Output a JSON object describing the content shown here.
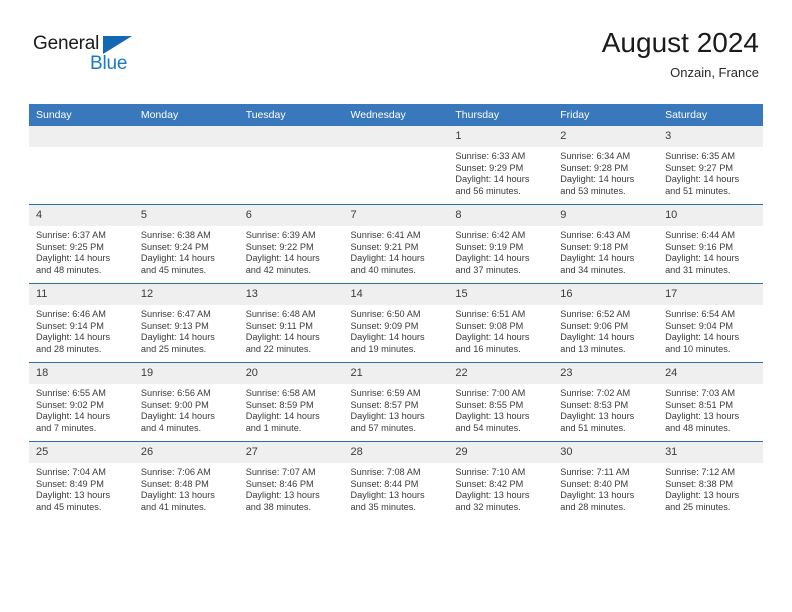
{
  "brand": {
    "name_dark": "General",
    "name_blue": "Blue",
    "triangle_color": "#1268b3",
    "blue_color": "#1a7bc4"
  },
  "header": {
    "month_title": "August 2024",
    "location": "Onzain, France"
  },
  "theme": {
    "header_bg": "#3a78bd",
    "row_border": "#2f6ca8",
    "daynum_bg": "#efefef",
    "text": "#3b3b3b"
  },
  "calendar": {
    "weekday_headers": [
      "Sunday",
      "Monday",
      "Tuesday",
      "Wednesday",
      "Thursday",
      "Friday",
      "Saturday"
    ],
    "weeks": [
      [
        {
          "day": "",
          "empty": true
        },
        {
          "day": "",
          "empty": true
        },
        {
          "day": "",
          "empty": true
        },
        {
          "day": "",
          "empty": true
        },
        {
          "day": "1",
          "sunrise": "Sunrise: 6:33 AM",
          "sunset": "Sunset: 9:29 PM",
          "daylight_1": "Daylight: 14 hours",
          "daylight_2": "and 56 minutes."
        },
        {
          "day": "2",
          "sunrise": "Sunrise: 6:34 AM",
          "sunset": "Sunset: 9:28 PM",
          "daylight_1": "Daylight: 14 hours",
          "daylight_2": "and 53 minutes."
        },
        {
          "day": "3",
          "sunrise": "Sunrise: 6:35 AM",
          "sunset": "Sunset: 9:27 PM",
          "daylight_1": "Daylight: 14 hours",
          "daylight_2": "and 51 minutes."
        }
      ],
      [
        {
          "day": "4",
          "sunrise": "Sunrise: 6:37 AM",
          "sunset": "Sunset: 9:25 PM",
          "daylight_1": "Daylight: 14 hours",
          "daylight_2": "and 48 minutes."
        },
        {
          "day": "5",
          "sunrise": "Sunrise: 6:38 AM",
          "sunset": "Sunset: 9:24 PM",
          "daylight_1": "Daylight: 14 hours",
          "daylight_2": "and 45 minutes."
        },
        {
          "day": "6",
          "sunrise": "Sunrise: 6:39 AM",
          "sunset": "Sunset: 9:22 PM",
          "daylight_1": "Daylight: 14 hours",
          "daylight_2": "and 42 minutes."
        },
        {
          "day": "7",
          "sunrise": "Sunrise: 6:41 AM",
          "sunset": "Sunset: 9:21 PM",
          "daylight_1": "Daylight: 14 hours",
          "daylight_2": "and 40 minutes."
        },
        {
          "day": "8",
          "sunrise": "Sunrise: 6:42 AM",
          "sunset": "Sunset: 9:19 PM",
          "daylight_1": "Daylight: 14 hours",
          "daylight_2": "and 37 minutes."
        },
        {
          "day": "9",
          "sunrise": "Sunrise: 6:43 AM",
          "sunset": "Sunset: 9:18 PM",
          "daylight_1": "Daylight: 14 hours",
          "daylight_2": "and 34 minutes."
        },
        {
          "day": "10",
          "sunrise": "Sunrise: 6:44 AM",
          "sunset": "Sunset: 9:16 PM",
          "daylight_1": "Daylight: 14 hours",
          "daylight_2": "and 31 minutes."
        }
      ],
      [
        {
          "day": "11",
          "sunrise": "Sunrise: 6:46 AM",
          "sunset": "Sunset: 9:14 PM",
          "daylight_1": "Daylight: 14 hours",
          "daylight_2": "and 28 minutes."
        },
        {
          "day": "12",
          "sunrise": "Sunrise: 6:47 AM",
          "sunset": "Sunset: 9:13 PM",
          "daylight_1": "Daylight: 14 hours",
          "daylight_2": "and 25 minutes."
        },
        {
          "day": "13",
          "sunrise": "Sunrise: 6:48 AM",
          "sunset": "Sunset: 9:11 PM",
          "daylight_1": "Daylight: 14 hours",
          "daylight_2": "and 22 minutes."
        },
        {
          "day": "14",
          "sunrise": "Sunrise: 6:50 AM",
          "sunset": "Sunset: 9:09 PM",
          "daylight_1": "Daylight: 14 hours",
          "daylight_2": "and 19 minutes."
        },
        {
          "day": "15",
          "sunrise": "Sunrise: 6:51 AM",
          "sunset": "Sunset: 9:08 PM",
          "daylight_1": "Daylight: 14 hours",
          "daylight_2": "and 16 minutes."
        },
        {
          "day": "16",
          "sunrise": "Sunrise: 6:52 AM",
          "sunset": "Sunset: 9:06 PM",
          "daylight_1": "Daylight: 14 hours",
          "daylight_2": "and 13 minutes."
        },
        {
          "day": "17",
          "sunrise": "Sunrise: 6:54 AM",
          "sunset": "Sunset: 9:04 PM",
          "daylight_1": "Daylight: 14 hours",
          "daylight_2": "and 10 minutes."
        }
      ],
      [
        {
          "day": "18",
          "sunrise": "Sunrise: 6:55 AM",
          "sunset": "Sunset: 9:02 PM",
          "daylight_1": "Daylight: 14 hours",
          "daylight_2": "and 7 minutes."
        },
        {
          "day": "19",
          "sunrise": "Sunrise: 6:56 AM",
          "sunset": "Sunset: 9:00 PM",
          "daylight_1": "Daylight: 14 hours",
          "daylight_2": "and 4 minutes."
        },
        {
          "day": "20",
          "sunrise": "Sunrise: 6:58 AM",
          "sunset": "Sunset: 8:59 PM",
          "daylight_1": "Daylight: 14 hours",
          "daylight_2": "and 1 minute."
        },
        {
          "day": "21",
          "sunrise": "Sunrise: 6:59 AM",
          "sunset": "Sunset: 8:57 PM",
          "daylight_1": "Daylight: 13 hours",
          "daylight_2": "and 57 minutes."
        },
        {
          "day": "22",
          "sunrise": "Sunrise: 7:00 AM",
          "sunset": "Sunset: 8:55 PM",
          "daylight_1": "Daylight: 13 hours",
          "daylight_2": "and 54 minutes."
        },
        {
          "day": "23",
          "sunrise": "Sunrise: 7:02 AM",
          "sunset": "Sunset: 8:53 PM",
          "daylight_1": "Daylight: 13 hours",
          "daylight_2": "and 51 minutes."
        },
        {
          "day": "24",
          "sunrise": "Sunrise: 7:03 AM",
          "sunset": "Sunset: 8:51 PM",
          "daylight_1": "Daylight: 13 hours",
          "daylight_2": "and 48 minutes."
        }
      ],
      [
        {
          "day": "25",
          "sunrise": "Sunrise: 7:04 AM",
          "sunset": "Sunset: 8:49 PM",
          "daylight_1": "Daylight: 13 hours",
          "daylight_2": "and 45 minutes."
        },
        {
          "day": "26",
          "sunrise": "Sunrise: 7:06 AM",
          "sunset": "Sunset: 8:48 PM",
          "daylight_1": "Daylight: 13 hours",
          "daylight_2": "and 41 minutes."
        },
        {
          "day": "27",
          "sunrise": "Sunrise: 7:07 AM",
          "sunset": "Sunset: 8:46 PM",
          "daylight_1": "Daylight: 13 hours",
          "daylight_2": "and 38 minutes."
        },
        {
          "day": "28",
          "sunrise": "Sunrise: 7:08 AM",
          "sunset": "Sunset: 8:44 PM",
          "daylight_1": "Daylight: 13 hours",
          "daylight_2": "and 35 minutes."
        },
        {
          "day": "29",
          "sunrise": "Sunrise: 7:10 AM",
          "sunset": "Sunset: 8:42 PM",
          "daylight_1": "Daylight: 13 hours",
          "daylight_2": "and 32 minutes."
        },
        {
          "day": "30",
          "sunrise": "Sunrise: 7:11 AM",
          "sunset": "Sunset: 8:40 PM",
          "daylight_1": "Daylight: 13 hours",
          "daylight_2": "and 28 minutes."
        },
        {
          "day": "31",
          "sunrise": "Sunrise: 7:12 AM",
          "sunset": "Sunset: 8:38 PM",
          "daylight_1": "Daylight: 13 hours",
          "daylight_2": "and 25 minutes."
        }
      ]
    ]
  }
}
